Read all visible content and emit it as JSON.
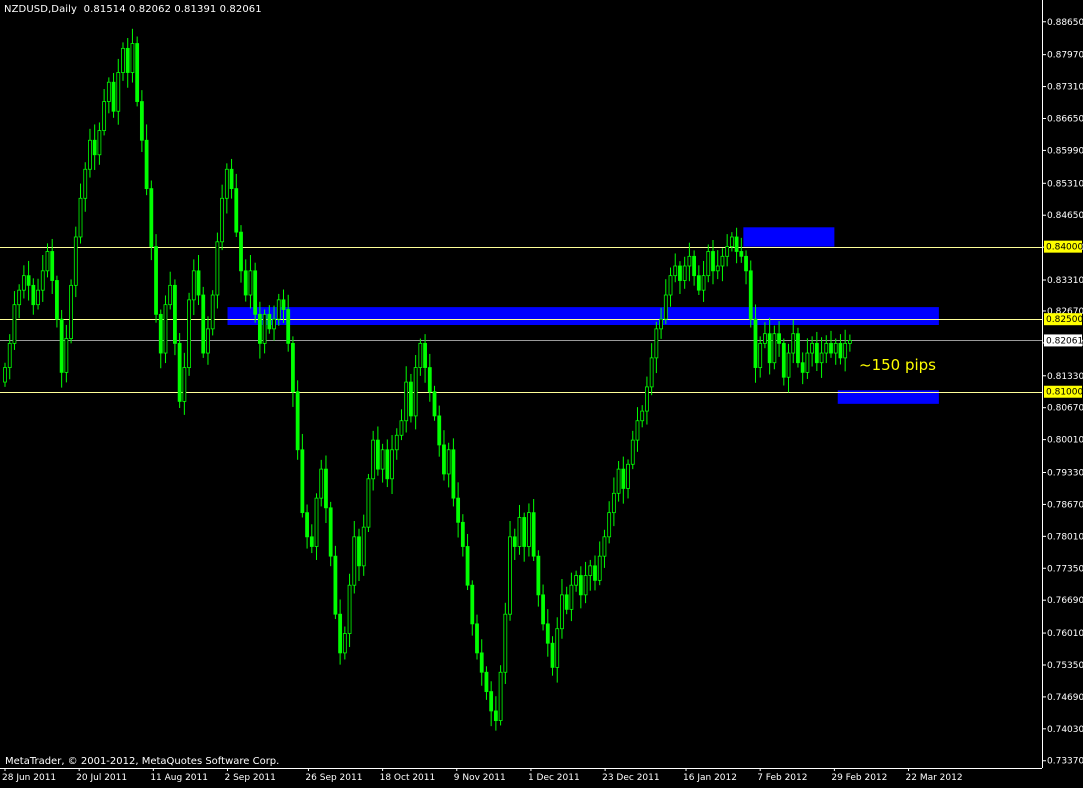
{
  "header": {
    "symbol_text": "NZDUSD,Daily",
    "ohlc_text": "0.81514 0.82062 0.81391 0.82061"
  },
  "footer": {
    "copyright": "MetaTrader, © 2001-2012, MetaQuotes Software Corp."
  },
  "annotation": {
    "text": "~150 pips"
  },
  "colors": {
    "background": "#000000",
    "candle": "#00ff00",
    "zone": "#0000ff",
    "level_line": "#ffff99",
    "level_label_bg": "#ffff00",
    "current_line": "#c0c0c0",
    "axis": "#ffffff",
    "annotation": "#ffff00"
  },
  "chart_data": {
    "type": "candlestick",
    "symbol": "NZDUSD",
    "timeframe": "Daily",
    "last_bar": {
      "open": 0.81514,
      "high": 0.82062,
      "low": 0.81391,
      "close": 0.82061
    },
    "y_ticks": [
      "0.88650",
      "0.87970",
      "0.87310",
      "0.86650",
      "0.85990",
      "0.85310",
      "0.84650",
      "0.83990",
      "0.83310",
      "0.82670",
      "0.82010",
      "0.81330",
      "0.80670",
      "0.80010",
      "0.79330",
      "0.78670",
      "0.78010",
      "0.77350",
      "0.76690",
      "0.76010",
      "0.75350",
      "0.74690",
      "0.74030",
      "0.73370"
    ],
    "ylim": [
      0.7322,
      0.891
    ],
    "x_ticks": [
      "28 Jun 2011",
      "20 Jul 2011",
      "11 Aug 2011",
      "2 Sep 2011",
      "26 Sep 2011",
      "18 Oct 2011",
      "9 Nov 2011",
      "1 Dec 2011",
      "23 Dec 2011",
      "16 Jan 2012",
      "7 Feb 2012",
      "29 Feb 2012",
      "22 Mar 2012"
    ],
    "levels": [
      {
        "price": 0.84,
        "label": "0.84000"
      },
      {
        "price": 0.825,
        "label": "0.82500"
      },
      {
        "price": 0.81,
        "label": "0.81000"
      }
    ],
    "current_price": {
      "price": 0.82061,
      "label": "0.82061"
    },
    "zones": [
      {
        "from_date": "2 Sep 2011",
        "to_date": "31 Mar 2012",
        "low": 0.8238,
        "high": 0.8275
      },
      {
        "from_date": "2 Feb 2012",
        "to_date": "29 Feb 2012",
        "low": 0.84,
        "high": 0.844
      },
      {
        "from_date": "1 Mar 2012",
        "to_date": "31 Mar 2012",
        "low": 0.8075,
        "high": 0.8103
      }
    ],
    "closes": [
      0.815,
      0.82,
      0.828,
      0.831,
      0.834,
      0.832,
      0.828,
      0.831,
      0.835,
      0.839,
      0.833,
      0.825,
      0.814,
      0.821,
      0.832,
      0.842,
      0.85,
      0.856,
      0.862,
      0.859,
      0.864,
      0.87,
      0.874,
      0.868,
      0.876,
      0.881,
      0.876,
      0.882,
      0.87,
      0.862,
      0.852,
      0.84,
      0.826,
      0.818,
      0.828,
      0.832,
      0.82,
      0.808,
      0.815,
      0.829,
      0.835,
      0.83,
      0.818,
      0.823,
      0.83,
      0.841,
      0.85,
      0.856,
      0.852,
      0.843,
      0.835,
      0.83,
      0.835,
      0.826,
      0.82,
      0.826,
      0.823,
      0.825,
      0.829,
      0.827,
      0.82,
      0.81,
      0.798,
      0.785,
      0.78,
      0.778,
      0.788,
      0.794,
      0.786,
      0.776,
      0.764,
      0.756,
      0.76,
      0.77,
      0.78,
      0.774,
      0.782,
      0.792,
      0.8,
      0.794,
      0.798,
      0.792,
      0.798,
      0.801,
      0.804,
      0.812,
      0.805,
      0.815,
      0.82,
      0.815,
      0.81,
      0.805,
      0.799,
      0.793,
      0.798,
      0.788,
      0.783,
      0.778,
      0.77,
      0.762,
      0.756,
      0.752,
      0.748,
      0.744,
      0.742,
      0.752,
      0.764,
      0.78,
      0.778,
      0.784,
      0.778,
      0.785,
      0.776,
      0.768,
      0.762,
      0.758,
      0.753,
      0.761,
      0.768,
      0.765,
      0.77,
      0.772,
      0.768,
      0.772,
      0.774,
      0.771,
      0.776,
      0.78,
      0.785,
      0.789,
      0.794,
      0.79,
      0.795,
      0.8,
      0.804,
      0.806,
      0.811,
      0.817,
      0.823,
      0.825,
      0.83,
      0.834,
      0.836,
      0.833,
      0.836,
      0.838,
      0.834,
      0.831,
      0.834,
      0.839,
      0.835,
      0.836,
      0.838,
      0.84,
      0.842,
      0.839,
      0.838,
      0.835,
      0.825,
      0.815,
      0.82,
      0.822,
      0.816,
      0.822,
      0.82,
      0.813,
      0.818,
      0.822,
      0.816,
      0.814,
      0.818,
      0.82,
      0.816,
      0.818,
      0.82,
      0.818,
      0.82,
      0.817,
      0.82,
      0.8206
    ]
  }
}
